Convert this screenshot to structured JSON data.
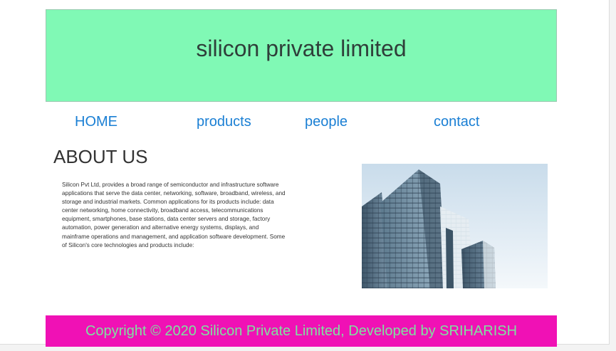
{
  "header": {
    "title": "silicon private limited",
    "background_color": "#80f9b5"
  },
  "nav": {
    "items": [
      {
        "label": "HOME"
      },
      {
        "label": "products"
      },
      {
        "label": "people"
      },
      {
        "label": "contact"
      }
    ],
    "link_color": "#1a7fd4"
  },
  "about": {
    "heading": "ABOUT US",
    "body": "Silicon Pvt Ltd, provides a broad range of semiconductor and infrastructure software applications that serve the data center, networking, software, broadband, wireless, and storage and industrial markets. Common applications for its products include: data center networking, home connectivity, broadband access, telecommunications equipment, smartphones, base stations, data center servers and storage, factory automation, power generation and alternative energy systems, displays, and mainframe operations and management, and application software development. Some of Silicon's core technologies and products include:"
  },
  "image": {
    "icon": "office-building-photo"
  },
  "footer": {
    "text": "Copyright © 2020 Silicon Private Limited, Developed by SRIHARISH",
    "background_color": "#f011b5",
    "text_color": "#7ee3a0"
  }
}
